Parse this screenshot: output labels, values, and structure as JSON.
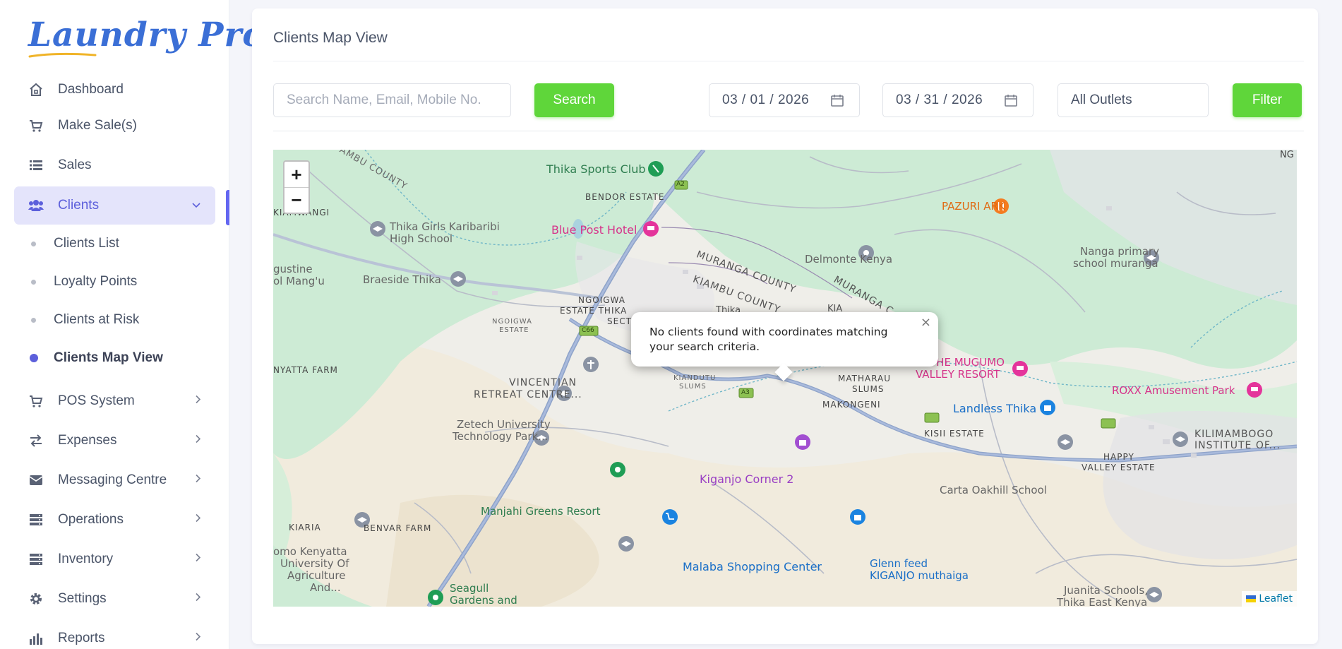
{
  "app": {
    "logo_text": "Laundry Pro"
  },
  "sidebar": {
    "items": [
      {
        "label": "Dashboard",
        "icon": "home-icon"
      },
      {
        "label": "Make Sale(s)",
        "icon": "cart-icon"
      },
      {
        "label": "Sales",
        "icon": "list-icon"
      },
      {
        "label": "Clients",
        "icon": "users-icon",
        "active": true
      },
      {
        "label": "POS System",
        "icon": "cart-icon"
      },
      {
        "label": "Expenses",
        "icon": "exchange-icon"
      },
      {
        "label": "Messaging Centre",
        "icon": "envelope-icon"
      },
      {
        "label": "Operations",
        "icon": "server-icon"
      },
      {
        "label": "Inventory",
        "icon": "server-icon"
      },
      {
        "label": "Settings",
        "icon": "gear-icon"
      },
      {
        "label": "Reports",
        "icon": "chart-icon"
      }
    ],
    "clients_sub": [
      {
        "label": "Clients List"
      },
      {
        "label": "Loyalty Points"
      },
      {
        "label": "Clients at Risk"
      },
      {
        "label": "Clients Map View",
        "active": true
      }
    ]
  },
  "main": {
    "title": "Clients Map View",
    "search_placeholder": "Search Name, Email, Mobile No.",
    "search_button": "Search",
    "date_from": "03 / 01 / 2026",
    "date_to": "03 / 31 / 2026",
    "outlet_select": "All Outlets",
    "filter_button": "Filter"
  },
  "map": {
    "zoom_in": "+",
    "zoom_out": "−",
    "popup_message": "No clients found with coordinates matching your search criteria.",
    "popup_close": "×",
    "attribution": "Leaflet",
    "labels": {
      "thika_sports_club": "Thika Sports Club",
      "bendor_estate": "BENDOR ESTATE",
      "blue_post_hotel": "Blue Post Hotel",
      "kiambu_county_top": "AMBU COUNTY",
      "kiamwangi": "KIAMWANGI",
      "thika_girls_1": "Thika Girls Karibaribi",
      "thika_girls_2": "High School",
      "augustine_1": "gustine",
      "augustine_2": "ol Mang'u",
      "braeside": "Braeside Thika",
      "ngoigwa_estate_thika": "NGOIGWA",
      "ngoigwa_estate_thika_2": "ESTATE THIKA",
      "ngoigwa_estate_thika_3": "SECT",
      "ngoigwa_small": "NGOIGWA",
      "ngoigwa_small_2": "ESTATE",
      "muranga_county": "MURANGA COUNTY",
      "kiambu_county_mid": "KIAMBU COUNTY",
      "muranga_county_2": "MURANGA C",
      "delmonte": "Delmonte Kenya",
      "pazuri_ark": "PAZURI ARK",
      "nanga_1": "Nanga primary",
      "nanga_2": "school muranga",
      "ng": "NG",
      "nyatta_farm": "NYATTA FARM",
      "vincentian_1": "VINCENTIAN",
      "vincentian_2": "RETREAT CENTRE...",
      "kiandutu_1": "KIANDUTU",
      "kiandutu_2": "SLUMS",
      "matharau_1": "MATHARAU",
      "matharau_2": "SLUMS",
      "makongeni": "MAKONGENI",
      "mugumo_1": "THE MUGUMO",
      "mugumo_2": "VALLEY RESORT",
      "roxx": "ROXX Amusement Park",
      "landless_thika": "Landless Thika",
      "kisii_estate": "KISII ESTATE",
      "happy_valley_1": "HAPPY",
      "happy_valley_2": "VALLEY ESTATE",
      "kilimambogo_1": "KILIMAMBOGO",
      "kilimambogo_2": "INSTITUTE OF...",
      "zetech_1": "Zetech University",
      "zetech_2": "Technology Park...",
      "kiganjo_corner": "Kiganjo Corner 2",
      "carta_oakhill": "Carta Oakhill School",
      "manjahi": "Manjahi Greens Resort",
      "kiaria": "KIARIA",
      "benvar_farm": "BENVAR FARM",
      "jkuat_1": "omo Kenyatta",
      "jkuat_2": "University Of",
      "jkuat_3": "Agriculture",
      "jkuat_4": "And...",
      "malaba": "Malaba Shopping Center",
      "glenn_feed_1": "Glenn feed",
      "glenn_feed_2": "KIGANJO muthaiga",
      "seagull_1": "Seagull",
      "seagull_2": "Gardens and",
      "juanita_1": "Juanita Schools,",
      "juanita_2": "Thika East Kenya",
      "kiri": "Thika",
      "kiambu_mid_2": "KIA",
      "road_a2": "A2",
      "road_c66": "C66",
      "road_a3": "A3"
    }
  },
  "colors": {
    "accent": "#5c5fdb",
    "button_green": "#5fd63a",
    "logo_blue": "#3b6fd6",
    "map_green": "#c8ead3",
    "map_road": "#8ea3c9"
  }
}
